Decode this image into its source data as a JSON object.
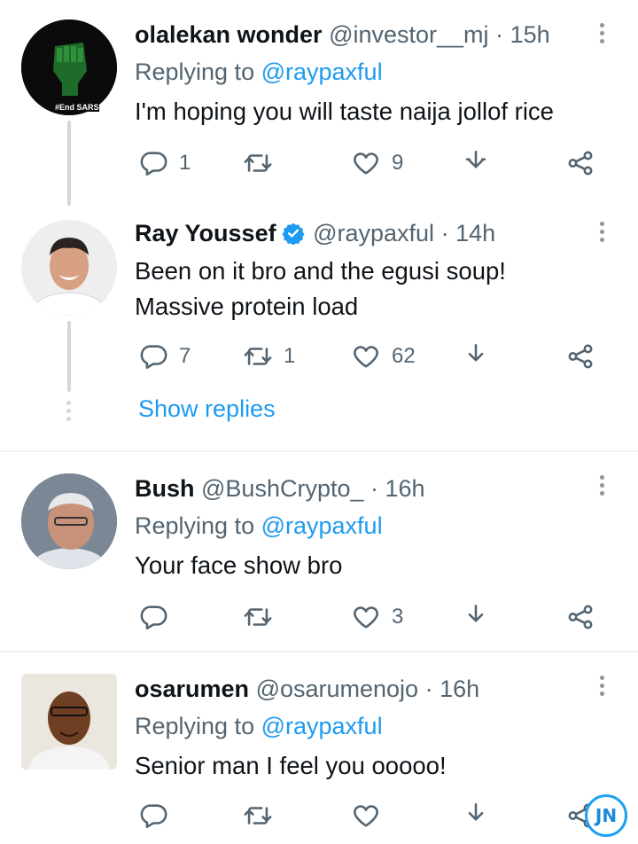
{
  "tweets": [
    {
      "name": "olalekan wonder",
      "handle": "@investor__mj",
      "time": "· 15h",
      "replying_prefix": "Replying to",
      "replying_to": "@raypaxful",
      "text_lines": [
        "I'm hoping you will taste naija jollof rice"
      ],
      "stats": {
        "replies": "1",
        "retweets": "",
        "likes": "9"
      },
      "avatar_label": "#End SARS"
    },
    {
      "name": "Ray Youssef",
      "handle": "@raypaxful",
      "time": "· 14h",
      "text_lines": [
        "Been on it bro and the egusi soup!",
        "Massive protein load"
      ],
      "stats": {
        "replies": "7",
        "retweets": "1",
        "likes": "62"
      },
      "verified": true
    },
    {
      "name": "Bush",
      "handle": "@BushCrypto_",
      "time": "· 16h",
      "replying_prefix": "Replying to",
      "replying_to": "@raypaxful",
      "text_lines": [
        "Your face show bro"
      ],
      "stats": {
        "replies": "",
        "retweets": "",
        "likes": "3"
      }
    },
    {
      "name": "osarumen",
      "handle": "@osarumenojo",
      "time": "· 16h",
      "replying_prefix": "Replying to",
      "replying_to": "@raypaxful",
      "text_lines": [
        "Senior man I feel you ooooo!"
      ],
      "stats": {
        "replies": "",
        "retweets": "",
        "likes": ""
      }
    }
  ],
  "show_replies_label": "Show replies",
  "watermark": "JN",
  "colors": {
    "accent": "#1d9bf0",
    "secondary_text": "#536471",
    "verified": "#1d9bf0"
  },
  "icons": [
    "reply-icon",
    "retweet-icon",
    "like-icon",
    "share-icon",
    "more-icon",
    "verified-icon"
  ]
}
